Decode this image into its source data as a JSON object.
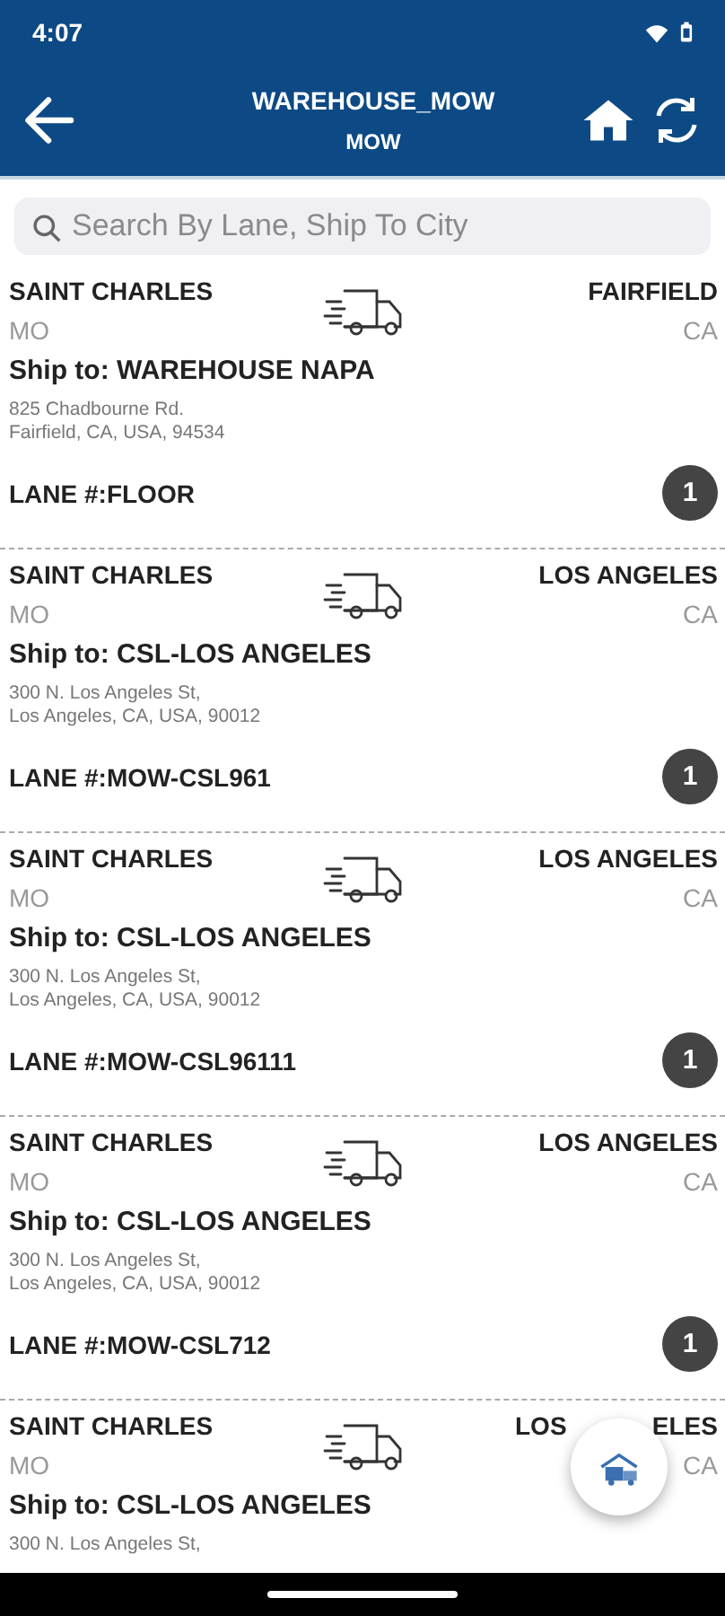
{
  "status_bar": {
    "time": "4:07"
  },
  "header": {
    "title": "WAREHOUSE_MOW",
    "subtitle": "MOW"
  },
  "search": {
    "placeholder": "Search By Lane, Ship To City"
  },
  "shipments": [
    {
      "origin_city": "SAINT CHARLES",
      "origin_state": "MO",
      "dest_city": "FAIRFIELD",
      "dest_state": "CA",
      "ship_to": "Ship to: WAREHOUSE NAPA",
      "address": [
        "825 Chadbourne Rd.",
        "Fairfield, CA, USA, 94534"
      ],
      "lane": "LANE #:FLOOR",
      "count": "1"
    },
    {
      "origin_city": "SAINT CHARLES",
      "origin_state": "MO",
      "dest_city": "LOS ANGELES",
      "dest_state": "CA",
      "ship_to": "Ship to: CSL-LOS ANGELES",
      "address": [
        "300 N. Los Angeles St,",
        "Los Angeles, CA, USA, 90012"
      ],
      "lane": "LANE #:MOW-CSL961",
      "count": "1"
    },
    {
      "origin_city": "SAINT CHARLES",
      "origin_state": "MO",
      "dest_city": "LOS ANGELES",
      "dest_state": "CA",
      "ship_to": "Ship to: CSL-LOS ANGELES",
      "address": [
        "300 N. Los Angeles St,",
        "Los Angeles, CA, USA, 90012"
      ],
      "lane": "LANE #:MOW-CSL96111",
      "count": "1"
    },
    {
      "origin_city": "SAINT CHARLES",
      "origin_state": "MO",
      "dest_city": "LOS ANGELES",
      "dest_state": "CA",
      "ship_to": "Ship to: CSL-LOS ANGELES",
      "address": [
        "300 N. Los Angeles St,",
        "Los Angeles, CA, USA, 90012"
      ],
      "lane": "LANE #:MOW-CSL712",
      "count": "1"
    },
    {
      "origin_city": "SAINT CHARLES",
      "origin_state": "MO",
      "dest_city_parts": [
        "LOS",
        "ELES"
      ],
      "dest_state": "CA",
      "ship_to": "Ship to: CSL-LOS ANGELES",
      "address": [
        "300 N. Los Angeles St,"
      ]
    }
  ]
}
